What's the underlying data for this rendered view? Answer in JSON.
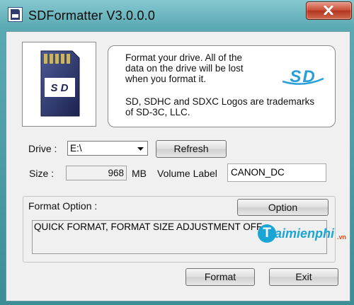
{
  "window": {
    "title": "SDFormatter V3.0.0.0"
  },
  "info": {
    "line1": "Format your drive. All of the",
    "line2": "data on the drive will be lost",
    "line3": "when you format it.",
    "trademark1": "SD, SDHC and SDXC Logos are trademarks",
    "trademark2": "of SD-3C, LLC."
  },
  "drive": {
    "label": "Drive :",
    "value": "E:\\",
    "refresh_label": "Refresh"
  },
  "size": {
    "label": "Size :",
    "value": "968",
    "unit": "MB"
  },
  "volume": {
    "label": "Volume Label",
    "value": "CANON_DC"
  },
  "format_option": {
    "label": "Format Option :",
    "option_button": "Option",
    "current": "QUICK FORMAT, FORMAT SIZE ADJUSTMENT OFF"
  },
  "buttons": {
    "format": "Format",
    "exit": "Exit"
  },
  "watermark": {
    "brand": "aimienphi",
    "tld": ".vn"
  },
  "colors": {
    "title_bar": "#5aa9b3",
    "close_button": "#c64a33",
    "sd_logo": "#2a9fd6",
    "card_body": "#2f3a6e"
  }
}
